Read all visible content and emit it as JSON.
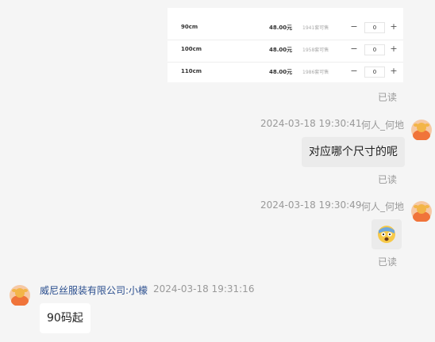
{
  "product_table": {
    "rows": [
      {
        "size": "90cm",
        "price": "48.00元",
        "stock": "1941套可售",
        "qty": "0"
      },
      {
        "size": "100cm",
        "price": "48.00元",
        "stock": "1958套可售",
        "qty": "0"
      },
      {
        "size": "110cm",
        "price": "48.00元",
        "stock": "1986套可售",
        "qty": "0"
      }
    ],
    "minus": "−",
    "plus": "+"
  },
  "messages": [
    {
      "read": "已读"
    },
    {
      "timestamp": "2024-03-18 19:30:41",
      "sender": "何人_何地",
      "text": "对应哪个尺寸的呢",
      "read": "已读"
    },
    {
      "timestamp": "2024-03-18 19:30:49",
      "sender": "何人_何地",
      "emoji": "scared-face-emoji",
      "read": "已读"
    },
    {
      "sender": "威尼丝服装有限公司:小檬",
      "timestamp": "2024-03-18 19:31:16",
      "text": "90码起"
    }
  ],
  "colors": {
    "avatar": "#f0743a",
    "avatar_face": "#f3b548",
    "link": "#2b4f8f",
    "bubble": "#ebebeb"
  }
}
